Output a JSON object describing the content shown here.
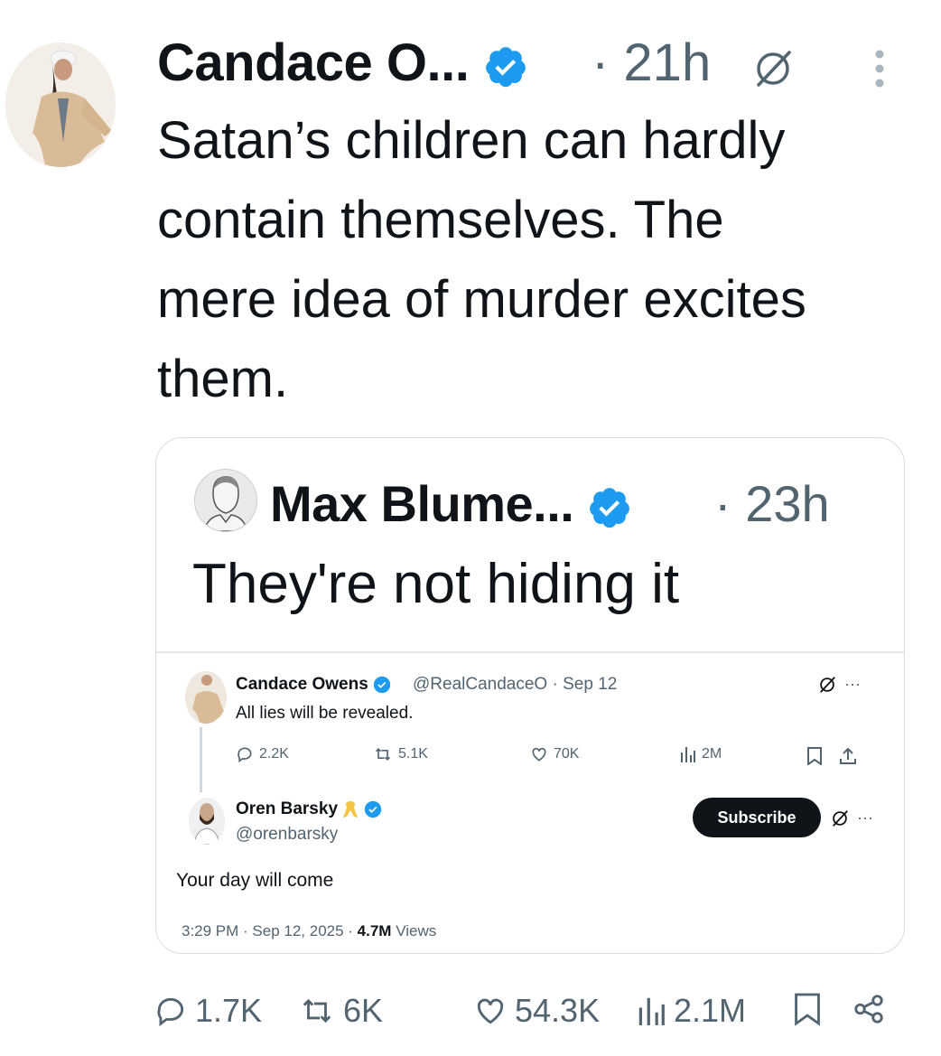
{
  "tweet": {
    "author_name": "Candace O...",
    "time": "· 21h",
    "text": "Satan’s children can hardly\ncontain themselves. The\nmere idea of murder excites\nthem."
  },
  "quote": {
    "author_name": "Max Blume...",
    "time": "· 23h",
    "text": "They're not hiding it",
    "embedded": {
      "post1": {
        "author_name": "Candace Owens",
        "handle_time": "@RealCandaceO · Sep 12",
        "text": "All lies will be revealed.",
        "replies": "2.2K",
        "reposts": "5.1K",
        "likes": "70K",
        "views": "2M"
      },
      "post2": {
        "author_name": "Oren Barsky",
        "handle": "@orenbarsky",
        "subscribe_label": "Subscribe",
        "text": "Your day will come",
        "meta_prefix": "3:29 PM · Sep 12, 2025 · ",
        "views_count": "4.7M",
        "views_suffix": " Views"
      }
    }
  },
  "actions": {
    "replies": "1.7K",
    "reposts": "6K",
    "likes": "54.3K",
    "views": "2.1M"
  },
  "colors": {
    "verified": "#1d9bf0",
    "text": "#0f1419",
    "muted": "#536471",
    "ribbon": "#f4c542"
  },
  "icons": [
    "verified-badge-icon",
    "grok-icon",
    "more-icon",
    "reply-icon",
    "repost-icon",
    "like-icon",
    "views-icon",
    "bookmark-icon",
    "share-icon",
    "yellow-ribbon-icon"
  ]
}
